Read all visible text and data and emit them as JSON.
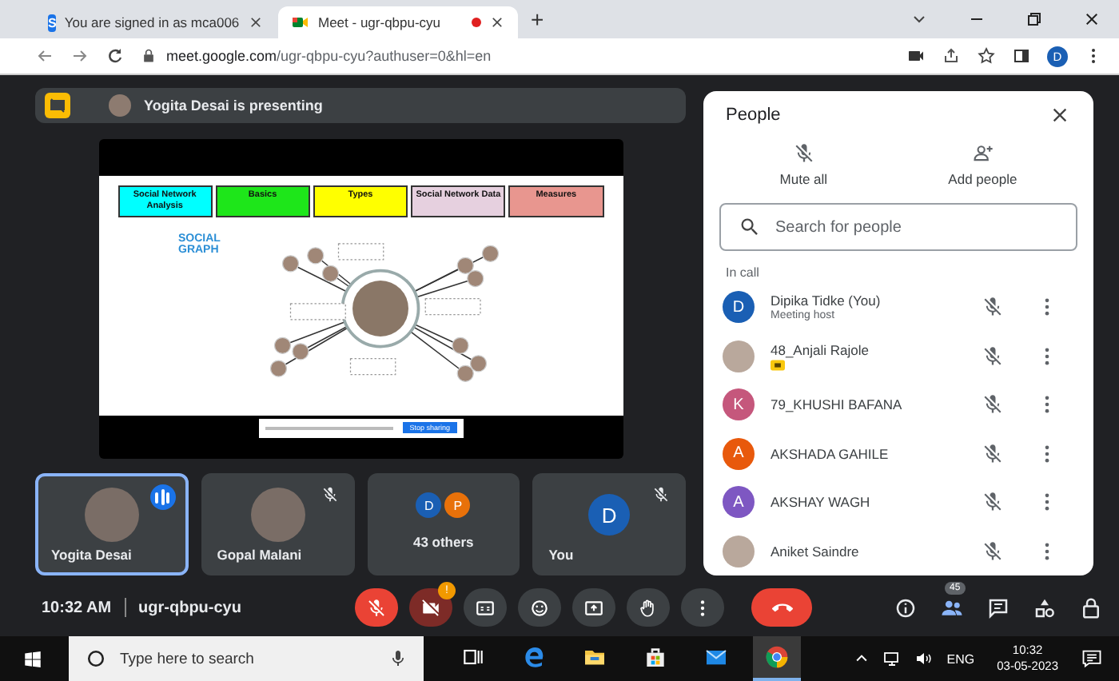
{
  "browser": {
    "tabs": [
      {
        "title": "You are signed in as mca006",
        "favicon_letter": "S",
        "kind": "site",
        "selected": false,
        "recording": false
      },
      {
        "title": "Meet - ugr-qbpu-cyu",
        "kind": "meet",
        "selected": true,
        "recording": true
      }
    ],
    "new_tab": "+",
    "url": {
      "host": "meet.google.com",
      "path": "/ugr-qbpu-cyu?authuser=0&hl=en"
    },
    "profile": "D"
  },
  "presenting": {
    "label": "Yogita Desai is presenting"
  },
  "slide": {
    "tabs": [
      {
        "label": "Social Network Analysis",
        "color": "#00ffff"
      },
      {
        "label": "Basics",
        "color": "#1ee61a"
      },
      {
        "label": "Types",
        "color": "#ffff00"
      },
      {
        "label": "Social Network Data",
        "color": "#e6d0df"
      },
      {
        "label": "Measures",
        "color": "#e8968f"
      }
    ],
    "graph_title": "SOCIAL GRAPH",
    "share_button": "Stop sharing"
  },
  "tiles": [
    {
      "name": "Yogita Desai",
      "kind": "photo",
      "selected": true,
      "speaking": true,
      "muted": false
    },
    {
      "name": "Gopal Malani",
      "kind": "photo",
      "selected": false,
      "speaking": false,
      "muted": true
    },
    {
      "name": "43 others",
      "kind": "group",
      "selected": false,
      "speaking": false,
      "muted": false,
      "avatars": [
        {
          "letter": "D",
          "color": "#1a5fb4"
        },
        {
          "letter": "P",
          "color": "#e8710a"
        }
      ]
    },
    {
      "name": "You",
      "kind": "letter",
      "letter": "D",
      "color": "#1a5fb4",
      "selected": false,
      "speaking": false,
      "muted": true
    }
  ],
  "toolbar": {
    "time": "10:32 AM",
    "meeting_code": "ugr-qbpu-cyu",
    "controls": [
      {
        "kind": "mic",
        "on": false
      },
      {
        "kind": "camera",
        "on": false,
        "badge": "!"
      },
      {
        "kind": "captions"
      },
      {
        "kind": "emoji"
      },
      {
        "kind": "present"
      },
      {
        "kind": "raise_hand"
      },
      {
        "kind": "more"
      },
      {
        "kind": "leave"
      }
    ],
    "side_controls": [
      {
        "kind": "info",
        "selected": false
      },
      {
        "kind": "people",
        "selected": true,
        "badge": "45"
      },
      {
        "kind": "chat",
        "selected": false
      },
      {
        "kind": "activities",
        "selected": false
      },
      {
        "kind": "host_controls",
        "selected": false
      }
    ]
  },
  "people_panel": {
    "title": "People",
    "actions": [
      {
        "kind": "mute_all",
        "label": "Mute all"
      },
      {
        "kind": "add_people",
        "label": "Add people"
      }
    ],
    "search": {
      "placeholder": "Search for people"
    },
    "section": "In call",
    "participants": [
      {
        "name": "Dipika Tidke (You)",
        "subtitle": "Meeting host",
        "avatar": {
          "kind": "letter",
          "letter": "D",
          "color": "#1a5fb4"
        },
        "muted": true,
        "presenting": false
      },
      {
        "name": "48_Anjali Rajole",
        "avatar": {
          "kind": "photo"
        },
        "muted": true,
        "presenting": true
      },
      {
        "name": "79_KHUSHI BAFANA",
        "avatar": {
          "kind": "letter",
          "letter": "K",
          "color": "#c5577c"
        },
        "muted": true,
        "presenting": false
      },
      {
        "name": "AKSHADA GAHILE",
        "avatar": {
          "kind": "letter",
          "letter": "A",
          "color": "#e8590c"
        },
        "muted": true,
        "presenting": false
      },
      {
        "name": "AKSHAY WAGH",
        "avatar": {
          "kind": "letter",
          "letter": "A",
          "color": "#7e57c2"
        },
        "muted": true,
        "presenting": false
      },
      {
        "name": "Aniket Saindre",
        "avatar": {
          "kind": "photo"
        },
        "muted": true,
        "presenting": false
      }
    ]
  },
  "taskbar": {
    "search_placeholder": "Type here to search",
    "apps": [
      {
        "kind": "task_view",
        "selected": false
      },
      {
        "kind": "edge",
        "selected": false
      },
      {
        "kind": "explorer",
        "selected": false
      },
      {
        "kind": "store",
        "selected": false
      },
      {
        "kind": "mail",
        "selected": false
      },
      {
        "kind": "chrome",
        "selected": true
      }
    ],
    "language": "ENG",
    "time": "10:32",
    "date": "03-05-2023"
  }
}
